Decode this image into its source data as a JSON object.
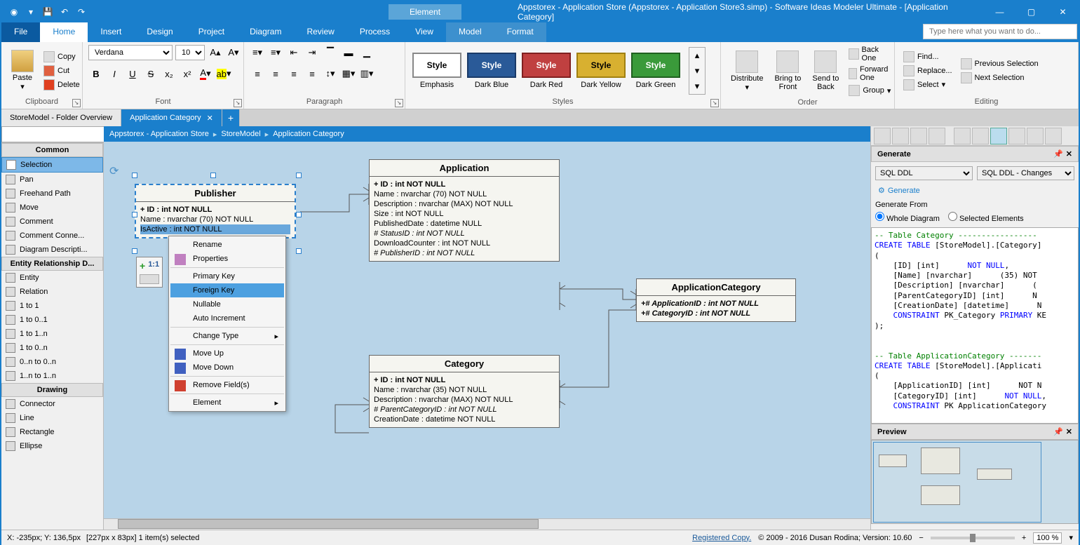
{
  "titlebar": {
    "context_tab": "Element",
    "title": "Appstorex - Application Store (Appstorex - Application Store3.simp)  - Software Ideas Modeler Ultimate - [Application Category]"
  },
  "menu": {
    "tabs": [
      "File",
      "Home",
      "Insert",
      "Design",
      "Project",
      "Diagram",
      "Review",
      "Process",
      "View",
      "Model",
      "Format"
    ],
    "active": "Home",
    "search_placeholder": "Type here what you want to do..."
  },
  "ribbon": {
    "clipboard": {
      "paste": "Paste",
      "copy": "Copy",
      "cut": "Cut",
      "delete": "Delete",
      "label": "Clipboard"
    },
    "font": {
      "family": "Verdana",
      "size": "10",
      "label": "Font"
    },
    "paragraph": {
      "label": "Paragraph"
    },
    "styles": {
      "label": "Styles",
      "items": [
        {
          "text": "Style",
          "sub": "Emphasis",
          "bg": "#ffffff",
          "border": "#888",
          "fg": "#000"
        },
        {
          "text": "Style",
          "sub": "Dark Blue",
          "bg": "#2a5a98",
          "border": "#1a3a68",
          "fg": "#fff"
        },
        {
          "text": "Style",
          "sub": "Dark Red",
          "bg": "#c04040",
          "border": "#802020",
          "fg": "#fff"
        },
        {
          "text": "Style",
          "sub": "Dark Yellow",
          "bg": "#d8b030",
          "border": "#a08010",
          "fg": "#000"
        },
        {
          "text": "Style",
          "sub": "Dark Green",
          "bg": "#3a9a3a",
          "border": "#206020",
          "fg": "#fff"
        }
      ]
    },
    "order": {
      "label": "Order",
      "distribute": "Distribute",
      "bring_front": "Bring to\nFront",
      "send_back": "Send to\nBack",
      "back_one": "Back One",
      "forward_one": "Forward One",
      "group": "Group"
    },
    "editing": {
      "label": "Editing",
      "find": "Find...",
      "replace": "Replace...",
      "select": "Select",
      "prev_sel": "Previous Selection",
      "next_sel": "Next Selection"
    }
  },
  "doc_tabs": {
    "tabs": [
      {
        "label": "StoreModel - Folder Overview",
        "active": false
      },
      {
        "label": "Application Category",
        "active": true
      }
    ]
  },
  "toolbox": {
    "common_hdr": "Common",
    "common": [
      "Selection",
      "Pan",
      "Freehand Path",
      "Move",
      "Comment",
      "Comment Conne...",
      "Diagram Descripti..."
    ],
    "erd_hdr": "Entity Relationship D...",
    "erd": [
      "Entity",
      "Relation",
      "1 to 1",
      "1 to 0..1",
      "1 to 1..n",
      "1 to 0..n",
      "0..n to 0..n",
      "1..n to 1..n"
    ],
    "drawing_hdr": "Drawing",
    "drawing": [
      "Connector",
      "Line",
      "Rectangle",
      "Ellipse"
    ],
    "selected": "Selection"
  },
  "breadcrumb": [
    "Appstorex - Application Store",
    "StoreModel",
    "Application Category"
  ],
  "entities": {
    "publisher": {
      "title": "Publisher",
      "attrs": [
        {
          "text": "+ ID : int NOT NULL",
          "pk": true
        },
        {
          "text": "Name : nvarchar (70)  NOT NULL"
        },
        {
          "text": "IsActive : int NOT NULL",
          "selected": true
        }
      ]
    },
    "application": {
      "title": "Application",
      "attrs": [
        {
          "text": "+ ID : int NOT NULL",
          "pk": true
        },
        {
          "text": "Name : nvarchar (70)  NOT NULL"
        },
        {
          "text": "Description : nvarchar (MAX)  NOT NULL"
        },
        {
          "text": "Size : int NOT NULL"
        },
        {
          "text": "PublishedDate : datetime NULL"
        },
        {
          "text": "# StatusID : int NOT NULL",
          "fk": true
        },
        {
          "text": "DownloadCounter : int NOT NULL"
        },
        {
          "text": "# PublisherID : int NOT NULL",
          "fk": true
        }
      ]
    },
    "appcategory": {
      "title": "ApplicationCategory",
      "attrs": [
        {
          "text": "+# ApplicationID : int NOT NULL",
          "pk": true,
          "fk": true
        },
        {
          "text": "+# CategoryID : int NOT NULL",
          "pk": true,
          "fk": true
        }
      ]
    },
    "category": {
      "title": "Category",
      "attrs": [
        {
          "text": "+ ID : int NOT NULL",
          "pk": true
        },
        {
          "text": "Name : nvarchar (35)  NOT NULL"
        },
        {
          "text": "Description : nvarchar (MAX)  NOT NULL"
        },
        {
          "text": "# ParentCategoryID : int NOT NULL",
          "fk": true
        },
        {
          "text": "CreationDate : datetime NOT NULL"
        }
      ]
    }
  },
  "context_menu": {
    "items": [
      {
        "label": "Rename"
      },
      {
        "label": "Properties",
        "sep": true,
        "icon": "#c080c0"
      },
      {
        "label": "Primary Key"
      },
      {
        "label": "Foreign Key",
        "highlighted": true
      },
      {
        "label": "Nullable"
      },
      {
        "label": "Auto Increment",
        "sep": true
      },
      {
        "label": "Change Type",
        "submenu": true,
        "sep": true
      },
      {
        "label": "Move Up",
        "icon": "#4060c0"
      },
      {
        "label": "Move Down",
        "icon": "#4060c0",
        "sep": true
      },
      {
        "label": "Remove Field(s)",
        "icon": "#d04030",
        "sep": true
      },
      {
        "label": "Element",
        "submenu": true
      }
    ]
  },
  "mini_toolbar": {
    "label": "1:1"
  },
  "right": {
    "generate_hdr": "Generate",
    "source_type": "SQL DDL",
    "template": "SQL DDL - Changes",
    "generate_btn": "Generate",
    "generate_from": "Generate From",
    "radio_whole": "Whole Diagram",
    "radio_selected": "Selected Elements",
    "sql": "-- Table Category -----------------\nCREATE TABLE [StoreModel].[Category]\n(\n    [ID] [int]      NOT NULL,\n    [Name] [nvarchar]      (35) NOT\n    [Description] [nvarchar]      (\n    [ParentCategoryID] [int]      N\n    [CreationDate] [datetime]      N\n    CONSTRAINT PK_Category PRIMARY KE\n);\n\n\n-- Table ApplicationCategory -------\nCREATE TABLE [StoreModel].[Applicati\n(\n    [ApplicationID] [int]      NOT N\n    [CategoryID] [int]      NOT NULL,\n    CONSTRAINT PK ApplicationCategory",
    "preview_hdr": "Preview"
  },
  "statusbar": {
    "coords": "X: -235px; Y: 136,5px",
    "selection": "[227px x 83px] 1 item(s) selected",
    "registered": "Registered Copy.",
    "copyright": "© 2009 - 2016 Dusan Rodina; Version: 10.60",
    "zoom": "100 %"
  }
}
